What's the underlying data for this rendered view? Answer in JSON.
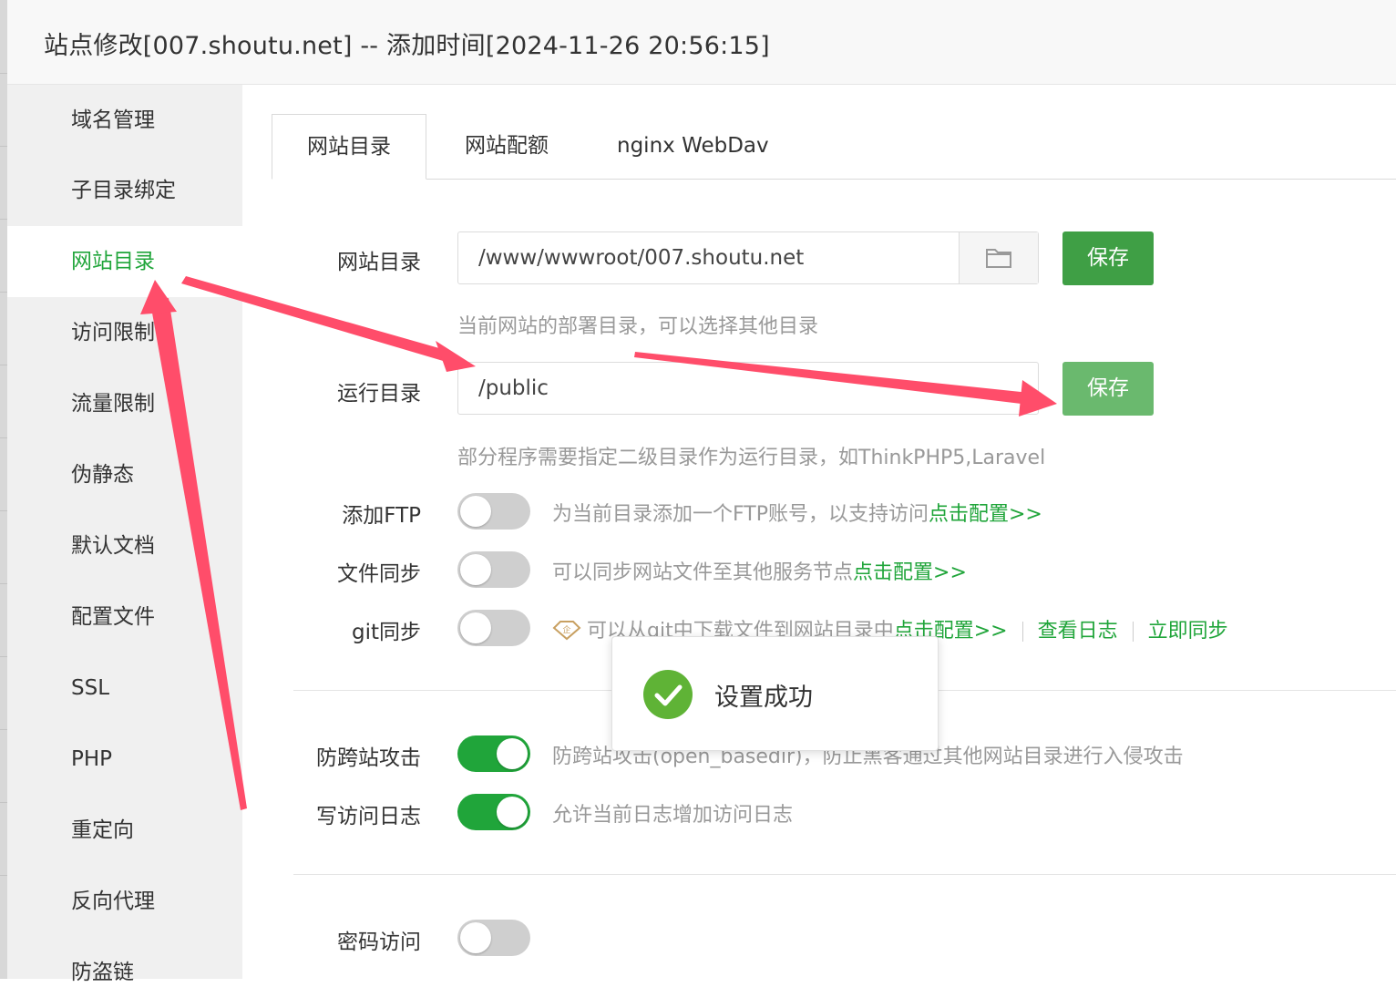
{
  "window": {
    "title": "站点修改[007.shoutu.net] -- 添加时间[2024-11-26 20:56:15]"
  },
  "sidebar": {
    "items": [
      {
        "label": "域名管理"
      },
      {
        "label": "子目录绑定"
      },
      {
        "label": "网站目录",
        "active": true
      },
      {
        "label": "访问限制"
      },
      {
        "label": "流量限制"
      },
      {
        "label": "伪静态"
      },
      {
        "label": "默认文档"
      },
      {
        "label": "配置文件"
      },
      {
        "label": "SSL"
      },
      {
        "label": "PHP"
      },
      {
        "label": "重定向"
      },
      {
        "label": "反向代理"
      },
      {
        "label": "防盗链"
      }
    ]
  },
  "tabs": [
    {
      "label": "网站目录",
      "active": true
    },
    {
      "label": "网站配额"
    },
    {
      "label": "nginx WebDav"
    }
  ],
  "site_dir": {
    "label": "网站目录",
    "value": "/www/wwwroot/007.shoutu.net",
    "save_label": "保存",
    "hint": "当前网站的部署目录，可以选择其他目录",
    "folder_icon": "folder-icon"
  },
  "run_dir": {
    "label": "运行目录",
    "value": "/public",
    "save_label": "保存",
    "hint": "部分程序需要指定二级目录作为运行目录，如ThinkPHP5,Laravel"
  },
  "ftp": {
    "label": "添加FTP",
    "enabled": false,
    "desc": "为当前目录添加一个FTP账号，以支持访问",
    "link": "点击配置>>"
  },
  "file_sync": {
    "label": "文件同步",
    "enabled": false,
    "desc": "可以同步网站文件至其他服务节点",
    "link": "点击配置>>"
  },
  "git_sync": {
    "label": "git同步",
    "enabled": false,
    "desc": "可以从git中下载文件到网站目录中",
    "link": "点击配置>>",
    "view_log": "查看日志",
    "sync_now": "立即同步",
    "badge_icon": "enterprise-diamond-icon"
  },
  "anti_xss": {
    "label": "防跨站攻击",
    "enabled": true,
    "desc": "防跨站攻击(open_basedir)，防止黑客通过其他网站目录进行入侵攻击"
  },
  "access_log": {
    "label": "写访问日志",
    "enabled": true,
    "desc": "允许当前日志增加访问日志"
  },
  "password_access": {
    "label": "密码访问",
    "enabled": false
  },
  "toast": {
    "message": "设置成功",
    "icon": "check-circle-icon"
  },
  "colors": {
    "accent": "#20a53a",
    "save_primary": "#3f9f45",
    "save_faded": "#6ab96e",
    "annotation_arrow": "#ff4d6a"
  }
}
